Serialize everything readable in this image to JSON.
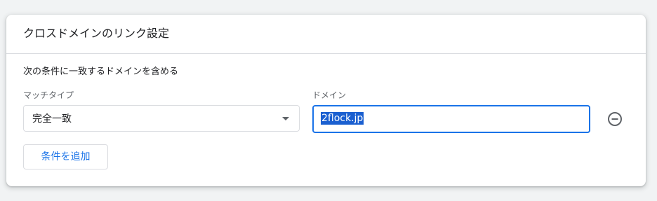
{
  "card": {
    "title": "クロスドメインのリンク設定",
    "section_label": "次の条件に一致するドメインを含める"
  },
  "condition": {
    "match_type_label": "マッチタイプ",
    "match_type_value": "完全一致",
    "domain_label": "ドメイン",
    "domain_value": "2flock.jp"
  },
  "actions": {
    "add_condition_label": "条件を追加",
    "remove_icon": "remove-circle-outline-icon",
    "dropdown_icon": "dropdown-arrow-icon"
  },
  "colors": {
    "accent": "#1a73e8",
    "selection": "#1a5fd0",
    "page_background": "#f1f3f4"
  }
}
